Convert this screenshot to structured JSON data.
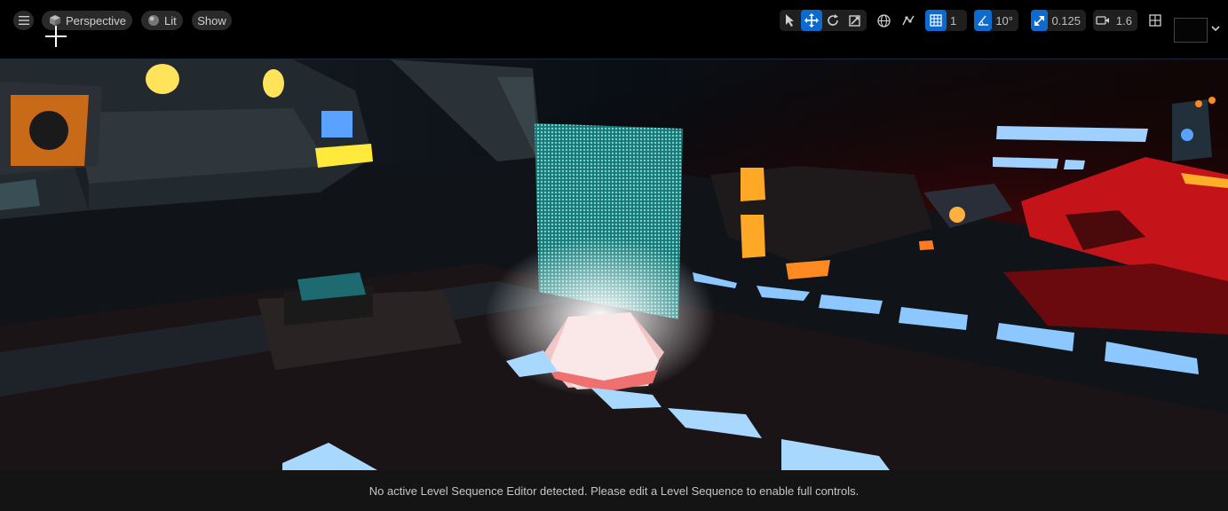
{
  "toolbar": {
    "perspective_label": "Perspective",
    "lit_label": "Lit",
    "show_label": "Show",
    "grid_snap_value": "1",
    "rotation_snap_value": "10°",
    "scale_snap_value": "0.125",
    "camera_speed_value": "1.6"
  },
  "status": {
    "message": "No active Level Sequence Editor detected. Please edit a Level Sequence to enable full controls."
  },
  "colors": {
    "accent": "#0d6bd0",
    "hologram": "#3ec9c4",
    "neon_blue": "#9fd0ff",
    "neon_red": "#d4141c",
    "neon_orange": "#ffa826"
  },
  "icons": [
    "menu-icon",
    "perspective-cube-icon",
    "lit-sphere-icon",
    "select-icon",
    "translate-icon",
    "rotate-icon",
    "scale-icon",
    "world-space-icon",
    "surface-snap-icon",
    "grid-snap-icon",
    "rotation-snap-icon",
    "scale-snap-icon",
    "camera-speed-icon",
    "layout-icon",
    "chevron-down-icon"
  ]
}
